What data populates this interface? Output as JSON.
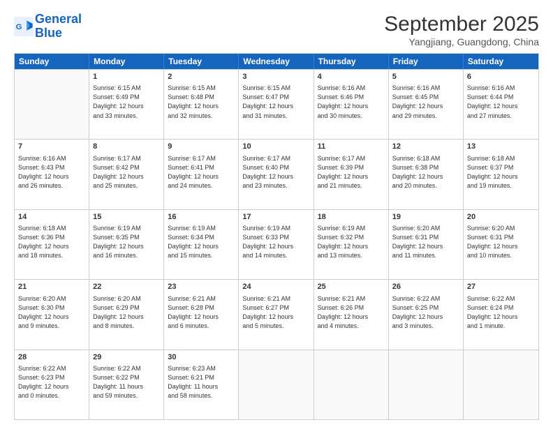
{
  "header": {
    "logo_line1": "General",
    "logo_line2": "Blue",
    "main_title": "September 2025",
    "subtitle": "Yangjiang, Guangdong, China"
  },
  "days_of_week": [
    "Sunday",
    "Monday",
    "Tuesday",
    "Wednesday",
    "Thursday",
    "Friday",
    "Saturday"
  ],
  "weeks": [
    [
      {
        "day": "",
        "info": ""
      },
      {
        "day": "1",
        "info": "Sunrise: 6:15 AM\nSunset: 6:49 PM\nDaylight: 12 hours\nand 33 minutes."
      },
      {
        "day": "2",
        "info": "Sunrise: 6:15 AM\nSunset: 6:48 PM\nDaylight: 12 hours\nand 32 minutes."
      },
      {
        "day": "3",
        "info": "Sunrise: 6:15 AM\nSunset: 6:47 PM\nDaylight: 12 hours\nand 31 minutes."
      },
      {
        "day": "4",
        "info": "Sunrise: 6:16 AM\nSunset: 6:46 PM\nDaylight: 12 hours\nand 30 minutes."
      },
      {
        "day": "5",
        "info": "Sunrise: 6:16 AM\nSunset: 6:45 PM\nDaylight: 12 hours\nand 29 minutes."
      },
      {
        "day": "6",
        "info": "Sunrise: 6:16 AM\nSunset: 6:44 PM\nDaylight: 12 hours\nand 27 minutes."
      }
    ],
    [
      {
        "day": "7",
        "info": "Sunrise: 6:16 AM\nSunset: 6:43 PM\nDaylight: 12 hours\nand 26 minutes."
      },
      {
        "day": "8",
        "info": "Sunrise: 6:17 AM\nSunset: 6:42 PM\nDaylight: 12 hours\nand 25 minutes."
      },
      {
        "day": "9",
        "info": "Sunrise: 6:17 AM\nSunset: 6:41 PM\nDaylight: 12 hours\nand 24 minutes."
      },
      {
        "day": "10",
        "info": "Sunrise: 6:17 AM\nSunset: 6:40 PM\nDaylight: 12 hours\nand 23 minutes."
      },
      {
        "day": "11",
        "info": "Sunrise: 6:17 AM\nSunset: 6:39 PM\nDaylight: 12 hours\nand 21 minutes."
      },
      {
        "day": "12",
        "info": "Sunrise: 6:18 AM\nSunset: 6:38 PM\nDaylight: 12 hours\nand 20 minutes."
      },
      {
        "day": "13",
        "info": "Sunrise: 6:18 AM\nSunset: 6:37 PM\nDaylight: 12 hours\nand 19 minutes."
      }
    ],
    [
      {
        "day": "14",
        "info": "Sunrise: 6:18 AM\nSunset: 6:36 PM\nDaylight: 12 hours\nand 18 minutes."
      },
      {
        "day": "15",
        "info": "Sunrise: 6:19 AM\nSunset: 6:35 PM\nDaylight: 12 hours\nand 16 minutes."
      },
      {
        "day": "16",
        "info": "Sunrise: 6:19 AM\nSunset: 6:34 PM\nDaylight: 12 hours\nand 15 minutes."
      },
      {
        "day": "17",
        "info": "Sunrise: 6:19 AM\nSunset: 6:33 PM\nDaylight: 12 hours\nand 14 minutes."
      },
      {
        "day": "18",
        "info": "Sunrise: 6:19 AM\nSunset: 6:32 PM\nDaylight: 12 hours\nand 13 minutes."
      },
      {
        "day": "19",
        "info": "Sunrise: 6:20 AM\nSunset: 6:31 PM\nDaylight: 12 hours\nand 11 minutes."
      },
      {
        "day": "20",
        "info": "Sunrise: 6:20 AM\nSunset: 6:31 PM\nDaylight: 12 hours\nand 10 minutes."
      }
    ],
    [
      {
        "day": "21",
        "info": "Sunrise: 6:20 AM\nSunset: 6:30 PM\nDaylight: 12 hours\nand 9 minutes."
      },
      {
        "day": "22",
        "info": "Sunrise: 6:20 AM\nSunset: 6:29 PM\nDaylight: 12 hours\nand 8 minutes."
      },
      {
        "day": "23",
        "info": "Sunrise: 6:21 AM\nSunset: 6:28 PM\nDaylight: 12 hours\nand 6 minutes."
      },
      {
        "day": "24",
        "info": "Sunrise: 6:21 AM\nSunset: 6:27 PM\nDaylight: 12 hours\nand 5 minutes."
      },
      {
        "day": "25",
        "info": "Sunrise: 6:21 AM\nSunset: 6:26 PM\nDaylight: 12 hours\nand 4 minutes."
      },
      {
        "day": "26",
        "info": "Sunrise: 6:22 AM\nSunset: 6:25 PM\nDaylight: 12 hours\nand 3 minutes."
      },
      {
        "day": "27",
        "info": "Sunrise: 6:22 AM\nSunset: 6:24 PM\nDaylight: 12 hours\nand 1 minute."
      }
    ],
    [
      {
        "day": "28",
        "info": "Sunrise: 6:22 AM\nSunset: 6:23 PM\nDaylight: 12 hours\nand 0 minutes."
      },
      {
        "day": "29",
        "info": "Sunrise: 6:22 AM\nSunset: 6:22 PM\nDaylight: 11 hours\nand 59 minutes."
      },
      {
        "day": "30",
        "info": "Sunrise: 6:23 AM\nSunset: 6:21 PM\nDaylight: 11 hours\nand 58 minutes."
      },
      {
        "day": "",
        "info": ""
      },
      {
        "day": "",
        "info": ""
      },
      {
        "day": "",
        "info": ""
      },
      {
        "day": "",
        "info": ""
      }
    ]
  ]
}
